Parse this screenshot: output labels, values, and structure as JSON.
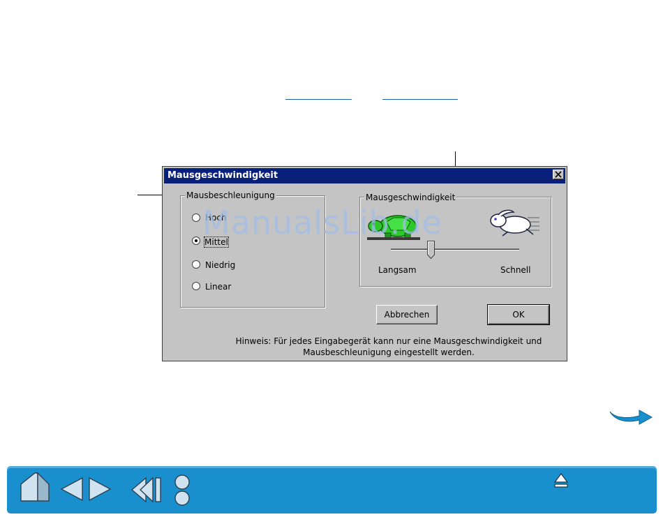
{
  "dialog": {
    "title": "Mausgeschwindigkeit",
    "accel_group": {
      "legend": "Mausbeschleunigung",
      "options": [
        {
          "label": "Hoch",
          "checked": false
        },
        {
          "label": "Mittel",
          "checked": true
        },
        {
          "label": "Niedrig",
          "checked": false
        },
        {
          "label": "Linear",
          "checked": false
        }
      ]
    },
    "speed_group": {
      "legend": "Mausgeschwindigkeit",
      "slow_label": "Langsam",
      "fast_label": "Schnell",
      "slider_level": 0.3,
      "slow_icon": "turtle-icon",
      "fast_icon": "rabbit-icon"
    },
    "buttons": {
      "cancel": "Abbrechen",
      "ok": "OK"
    },
    "note_line1": "Hinweis: Für jedes Eingabegerät kann nur eine Mausgeschwindigkeit und",
    "note_line2": "Mausbeschleunigung eingestellt werden."
  },
  "watermark": "ManualsLib.de",
  "navigation": {
    "icons": [
      "home-icon",
      "previous-page-icon",
      "next-page-icon",
      "back-icon",
      "contents-index-icon",
      "top-of-page-icon",
      "next-arrow-icon"
    ]
  },
  "colors": {
    "titlebar": "#08207a",
    "navbar": "#1a8fcd",
    "dialog_bg": "#c4c4c4"
  }
}
